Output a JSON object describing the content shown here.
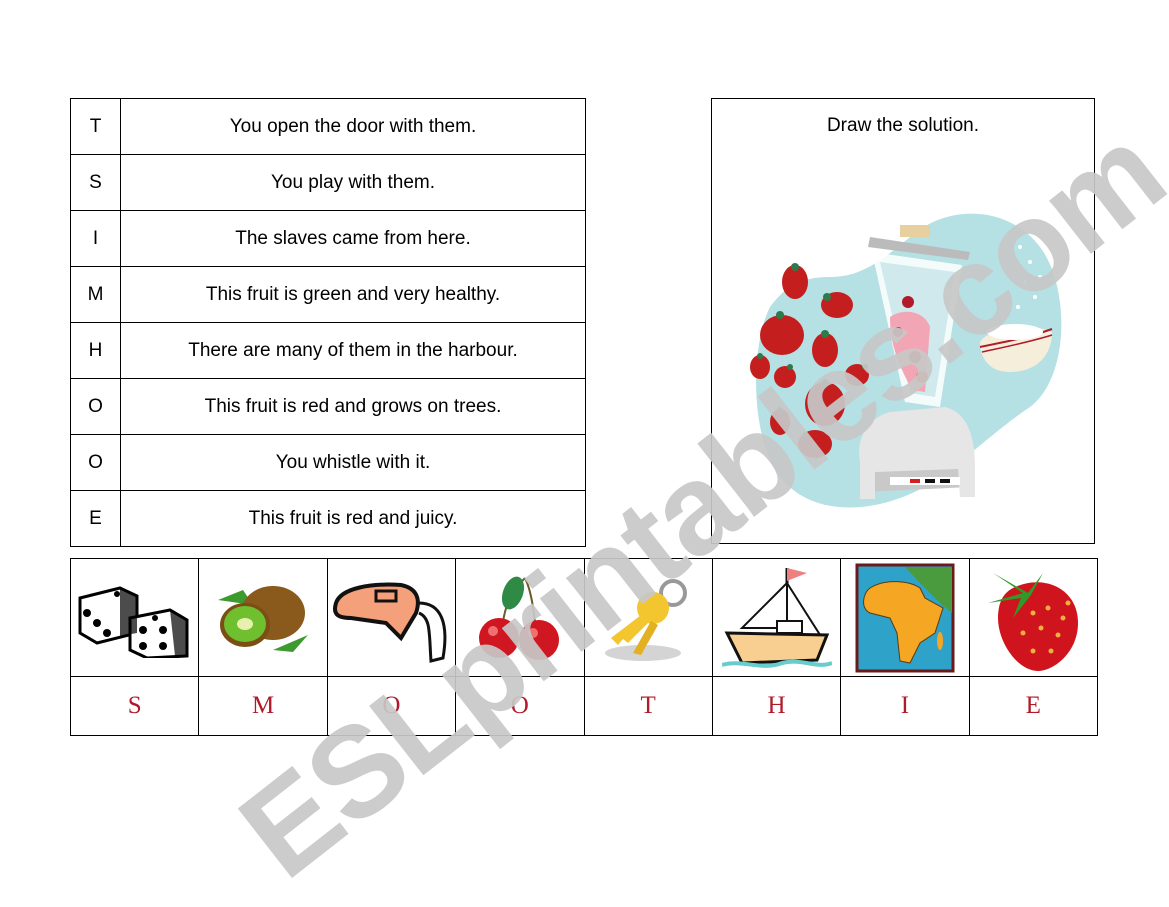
{
  "clues": [
    {
      "letter": "T",
      "text": "You open the door with them."
    },
    {
      "letter": "S",
      "text": "You play with them."
    },
    {
      "letter": "I",
      "text": "The slaves came from here."
    },
    {
      "letter": "M",
      "text": "This fruit is green and very healthy."
    },
    {
      "letter": "H",
      "text": "There are many of them in the harbour."
    },
    {
      "letter": "O",
      "text": "This fruit is red and grows on trees."
    },
    {
      "letter": "O",
      "text": "You whistle with it."
    },
    {
      "letter": "E",
      "text": "This fruit is red and juicy."
    }
  ],
  "solution_box": {
    "title": "Draw the solution.",
    "image": "smoothie-blender-illustration"
  },
  "picture_row": [
    {
      "image": "dice",
      "letter": "S"
    },
    {
      "image": "kiwi",
      "letter": "M"
    },
    {
      "image": "whistle",
      "letter": "O"
    },
    {
      "image": "cherries",
      "letter": "O"
    },
    {
      "image": "keys",
      "letter": "T"
    },
    {
      "image": "boat",
      "letter": "H"
    },
    {
      "image": "africa-map",
      "letter": "I"
    },
    {
      "image": "strawberry",
      "letter": "E"
    }
  ],
  "letter_color": "#b01a2a",
  "watermark": "ESLprintables.com"
}
